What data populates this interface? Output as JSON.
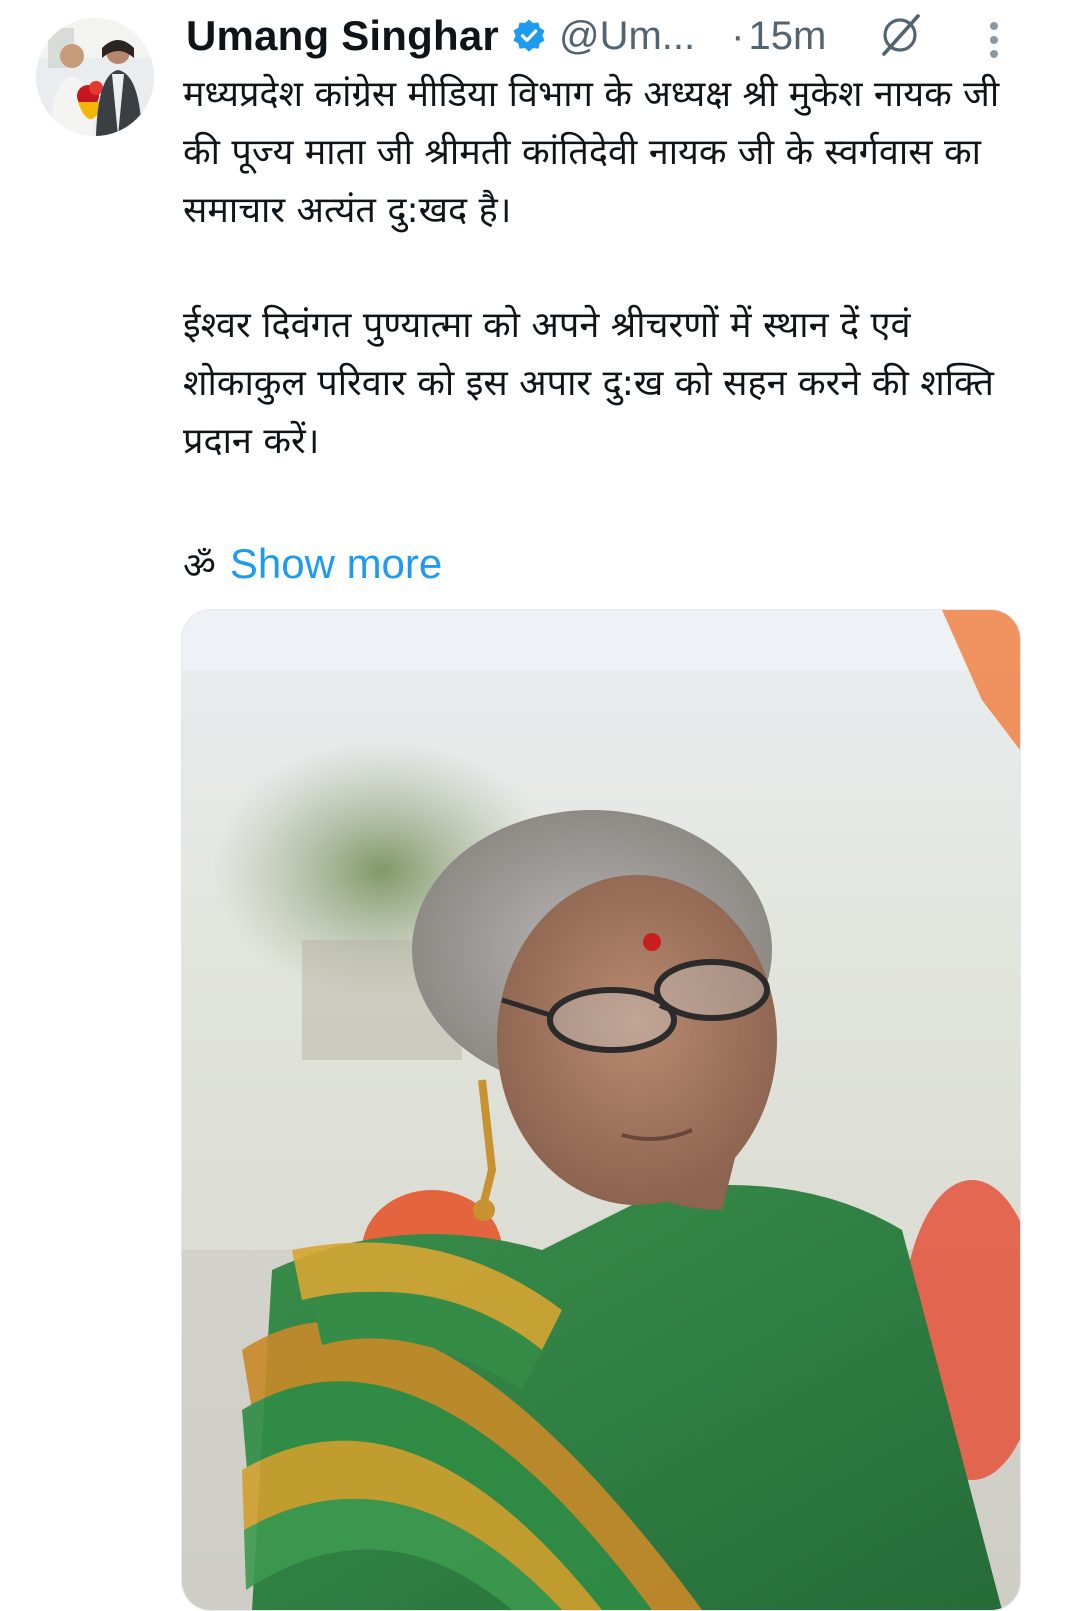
{
  "tweet": {
    "author": {
      "display_name": "Umang Singhar",
      "handle": "@Um...",
      "verified": true,
      "avatar_icon": "avatar-photo"
    },
    "separator": "·",
    "time": "15m",
    "header_icons": [
      "grok-icon",
      "more-vertical-icon"
    ],
    "text": {
      "paragraph_1": "मध्यप्रदेश कांग्रेस मीडिया विभाग के अध्यक्ष श्री मुकेश नायक जी की पूज्य माता जी श्रीमती कांतिदेवी नायक जी के स्वर्गवास का समाचार अत्यंत दु:खद है।",
      "paragraph_2": "ईश्वर दिवंगत पुण्यात्मा को अपने श्रीचरणों में स्थान दें एवं शोकाकुल परिवार को इस अपार दु:ख को सहन करने की शक्ति प्रदान करें।",
      "om_symbol": "ॐ",
      "show_more": "Show more"
    },
    "media": {
      "type": "photo"
    }
  },
  "colors": {
    "text_primary": "#0f1419",
    "text_secondary": "#536471",
    "link": "#1d9bf0",
    "verified": "#1d9bf0"
  }
}
